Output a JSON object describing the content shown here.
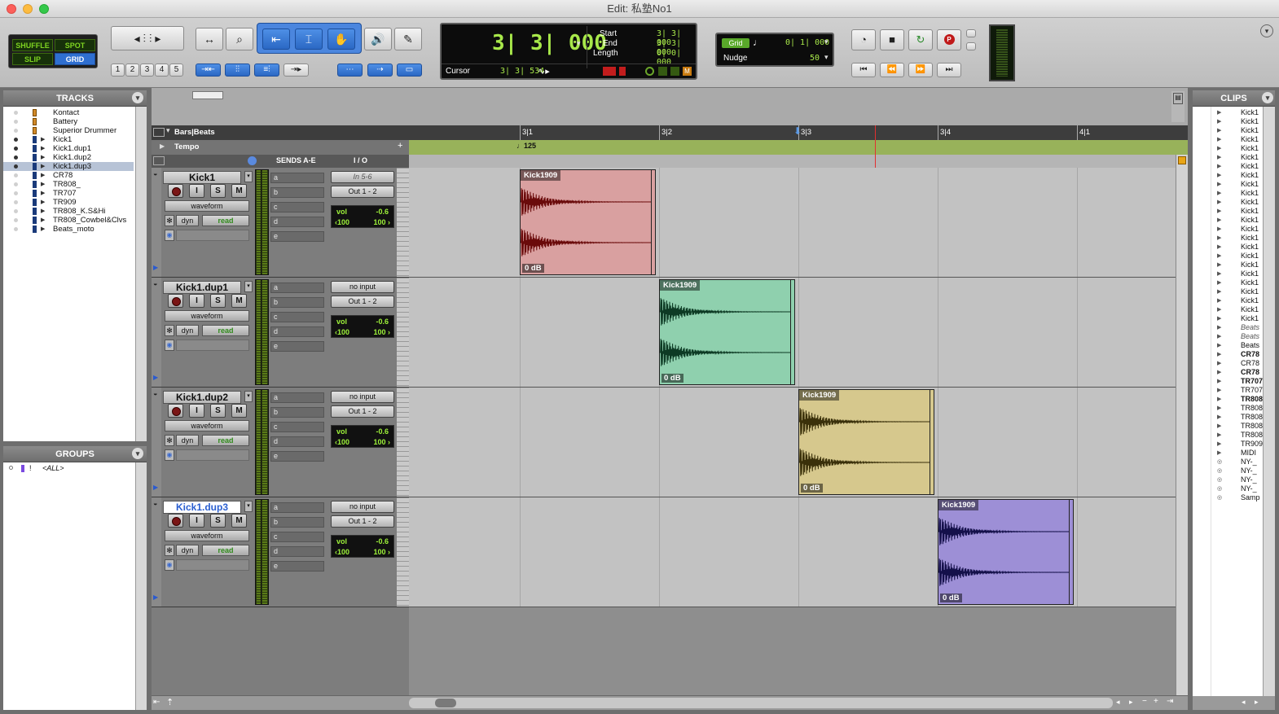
{
  "window": {
    "title": "Edit: 私塾No1"
  },
  "toolbar": {
    "modes": [
      "SHUFFLE",
      "SPOT",
      "SLIP",
      "GRID"
    ],
    "zoom_presets": [
      "1",
      "2",
      "3",
      "4",
      "5"
    ],
    "counter": {
      "main": "3| 3| 000",
      "start_label": "Start",
      "start": "3| 3| 000",
      "end_label": "End",
      "end": "3| 3| 000",
      "length_label": "Length",
      "length": "0| 0| 000",
      "cursor_label": "Cursor",
      "cursor": "3| 3| 534"
    },
    "grid": {
      "label": "Grid",
      "value": "0| 1| 000"
    },
    "nudge": {
      "label": "Nudge",
      "value": "50"
    }
  },
  "tracks_panel": {
    "title": "TRACKS",
    "items": [
      {
        "name": "Kontact",
        "type": "inst"
      },
      {
        "name": "Battery",
        "type": "inst"
      },
      {
        "name": "Superior Drummer",
        "type": "inst"
      },
      {
        "name": "Kick1",
        "type": "audio"
      },
      {
        "name": "Kick1.dup1",
        "type": "audio"
      },
      {
        "name": "Kick1.dup2",
        "type": "audio"
      },
      {
        "name": "Kick1.dup3",
        "type": "audio",
        "selected": true
      },
      {
        "name": "CR78",
        "type": "audio"
      },
      {
        "name": "TR808_",
        "type": "audio"
      },
      {
        "name": "TR707",
        "type": "audio"
      },
      {
        "name": "TR909",
        "type": "audio"
      },
      {
        "name": "TR808_K.S&Hi",
        "type": "audio"
      },
      {
        "name": "TR808_Cowbel&Clvs",
        "type": "audio"
      },
      {
        "name": "Beats_moto",
        "type": "audio"
      }
    ]
  },
  "groups_panel": {
    "title": "GROUPS",
    "all": "<ALL>",
    "flag": "!"
  },
  "ruler": {
    "timebase": "Bars|Beats",
    "tempo_label": "Tempo",
    "tempo_value": "125",
    "bars": [
      "3|1",
      "3|2",
      "3|3",
      "3|4",
      "4|1"
    ]
  },
  "columns": {
    "sends": "SENDS A-E",
    "io": "I / O"
  },
  "edit_tracks": [
    {
      "name": "Kick1",
      "input": "In 5-6",
      "output": "Out 1 - 2",
      "view": "waveform",
      "dyn": "dyn",
      "auto": "read",
      "vol_label": "vol",
      "vol": "-0.6",
      "pan_l": "‹100",
      "pan_r": "100 ›",
      "sends": [
        "a",
        "b",
        "c",
        "d",
        "e"
      ],
      "selected": false,
      "clip": {
        "name": "Kick1909",
        "gain": "0 dB",
        "color": "#d9a0a0",
        "wave": "#6a0a0a",
        "bar_start": 1
      }
    },
    {
      "name": "Kick1.dup1",
      "input": "no input",
      "output": "Out 1 - 2",
      "view": "waveform",
      "dyn": "dyn",
      "auto": "read",
      "vol_label": "vol",
      "vol": "-0.6",
      "pan_l": "‹100",
      "pan_r": "100 ›",
      "sends": [
        "a",
        "b",
        "c",
        "d",
        "e"
      ],
      "selected": false,
      "clip": {
        "name": "Kick1909",
        "gain": "0 dB",
        "color": "#8fd0ae",
        "wave": "#0d3a24",
        "bar_start": 2
      }
    },
    {
      "name": "Kick1.dup2",
      "input": "no input",
      "output": "Out 1 - 2",
      "view": "waveform",
      "dyn": "dyn",
      "auto": "read",
      "vol_label": "vol",
      "vol": "-0.6",
      "pan_l": "‹100",
      "pan_r": "100 ›",
      "sends": [
        "a",
        "b",
        "c",
        "d",
        "e"
      ],
      "selected": false,
      "clip": {
        "name": "Kick1909",
        "gain": "0 dB",
        "color": "#d6c88d",
        "wave": "#3a300a",
        "bar_start": 3
      }
    },
    {
      "name": "Kick1.dup3",
      "input": "no input",
      "output": "Out 1 - 2",
      "view": "waveform",
      "dyn": "dyn",
      "auto": "read",
      "vol_label": "vol",
      "vol": "-0.6",
      "pan_l": "‹100",
      "pan_r": "100 ›",
      "sends": [
        "a",
        "b",
        "c",
        "d",
        "e"
      ],
      "selected": true,
      "clip": {
        "name": "Kick1909",
        "gain": "0 dB",
        "color": "#9d8fd6",
        "wave": "#14104a",
        "bar_start": 4
      }
    }
  ],
  "clips_panel": {
    "title": "CLIPS",
    "items": [
      {
        "t": "Kick1",
        "s": ""
      },
      {
        "t": "Kick1",
        "s": ""
      },
      {
        "t": "Kick1",
        "s": ""
      },
      {
        "t": "Kick1",
        "s": ""
      },
      {
        "t": "Kick1",
        "s": ""
      },
      {
        "t": "Kick1",
        "s": ""
      },
      {
        "t": "Kick1",
        "s": ""
      },
      {
        "t": "Kick1",
        "s": ""
      },
      {
        "t": "Kick1",
        "s": ""
      },
      {
        "t": "Kick1",
        "s": ""
      },
      {
        "t": "Kick1",
        "s": ""
      },
      {
        "t": "Kick1",
        "s": ""
      },
      {
        "t": "Kick1",
        "s": ""
      },
      {
        "t": "Kick1",
        "s": ""
      },
      {
        "t": "Kick1",
        "s": ""
      },
      {
        "t": "Kick1",
        "s": ""
      },
      {
        "t": "Kick1",
        "s": ""
      },
      {
        "t": "Kick1",
        "s": ""
      },
      {
        "t": "Kick1",
        "s": ""
      },
      {
        "t": "Kick1",
        "s": ""
      },
      {
        "t": "Kick1",
        "s": ""
      },
      {
        "t": "Kick1",
        "s": ""
      },
      {
        "t": "Kick1",
        "s": ""
      },
      {
        "t": "Kick1",
        "s": ""
      },
      {
        "t": "Beats",
        "s": "it"
      },
      {
        "t": "Beats",
        "s": "it"
      },
      {
        "t": "Beats",
        "s": ""
      },
      {
        "t": "CR78",
        "s": "b"
      },
      {
        "t": "CR78",
        "s": ""
      },
      {
        "t": "CR78",
        "s": "b"
      },
      {
        "t": "TR707",
        "s": "b"
      },
      {
        "t": "TR707",
        "s": ""
      },
      {
        "t": "TR808",
        "s": "b"
      },
      {
        "t": "TR808",
        "s": ""
      },
      {
        "t": "TR808",
        "s": ""
      },
      {
        "t": "TR808",
        "s": ""
      },
      {
        "t": "TR808",
        "s": ""
      },
      {
        "t": "TR909",
        "s": ""
      },
      {
        "t": "MIDI",
        "s": ""
      },
      {
        "t": "NY-_",
        "s": ""
      },
      {
        "t": "NY-_",
        "s": ""
      },
      {
        "t": "NY-_",
        "s": ""
      },
      {
        "t": "NY-_",
        "s": ""
      },
      {
        "t": "Samp",
        "s": ""
      }
    ]
  }
}
